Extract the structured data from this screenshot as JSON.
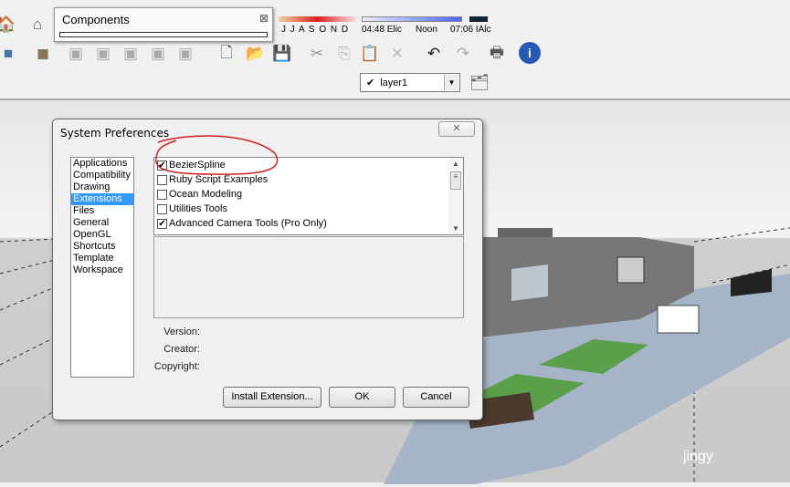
{
  "components_panel": {
    "title": "Components",
    "close": "⊠"
  },
  "shadow_bar": {
    "months": "J J A S O N D",
    "time_start": "04:48 Elic",
    "noon": "Noon",
    "time_end": "07:06 IAlc"
  },
  "layer_select": {
    "value": "layer1",
    "check": "✔"
  },
  "dialog": {
    "title": "System Preferences",
    "close": "✕",
    "categories": [
      "Applications",
      "Compatibility",
      "Drawing",
      "Extensions",
      "Files",
      "General",
      "OpenGL",
      "Shortcuts",
      "Template",
      "Workspace"
    ],
    "selected_category": "Extensions",
    "extensions": [
      {
        "name": "BezierSpline",
        "checked": true
      },
      {
        "name": "Ruby Script Examples",
        "checked": false
      },
      {
        "name": "Ocean Modeling",
        "checked": false
      },
      {
        "name": "Utilities Tools",
        "checked": false
      },
      {
        "name": "Advanced Camera Tools (Pro Only)",
        "checked": true
      }
    ],
    "version_label": "Version:",
    "creator_label": "Creator:",
    "copyright_label": "Copyright:",
    "install_button": "Install Extension...",
    "ok_button": "OK",
    "cancel_button": "Cancel"
  },
  "watermark": "jingy",
  "colors": {
    "selection": "#3399ff",
    "annotation": "#d42020"
  }
}
